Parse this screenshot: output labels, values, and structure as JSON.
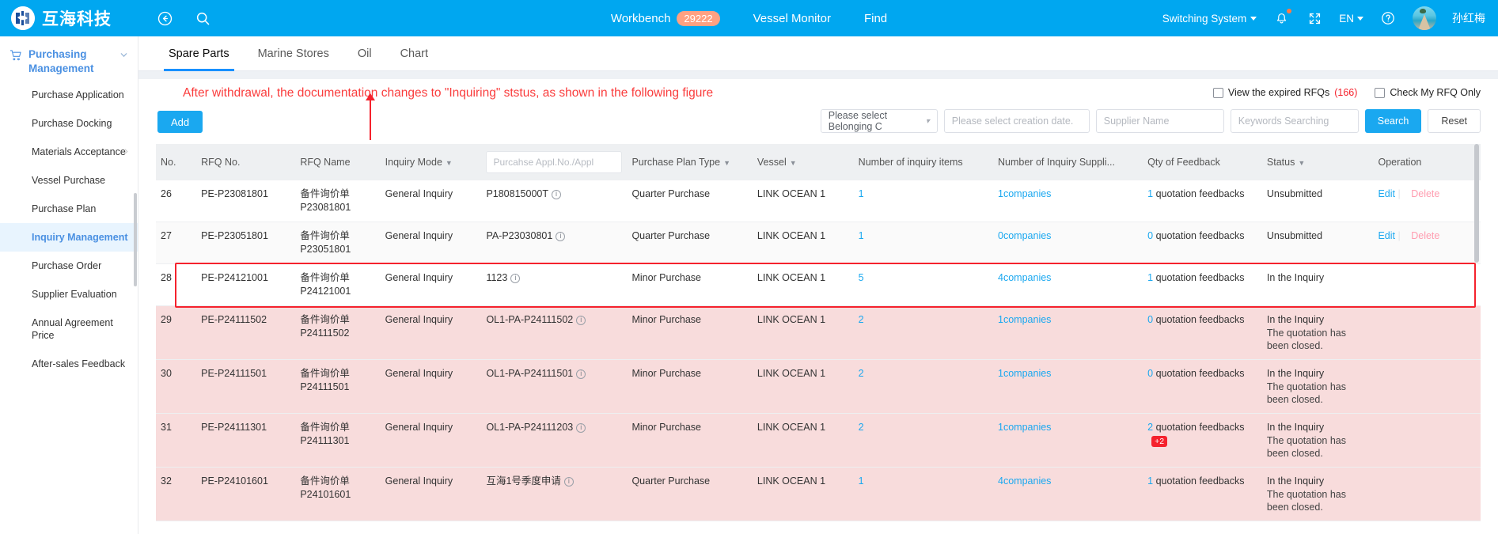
{
  "topbar": {
    "brand": "互海科技",
    "back_icon": "back-arrow-icon",
    "search_icon": "search-icon",
    "workbench_label": "Workbench",
    "workbench_count": "29222",
    "vessel_monitor_label": "Vessel Monitor",
    "find_label": "Find",
    "switching_system_label": "Switching System",
    "bell_icon": "bell-icon",
    "fullscreen_icon": "fullscreen-icon",
    "language": "EN",
    "help_icon": "help-icon",
    "username": "孙红梅",
    "accent_color": "#00a7f0",
    "badge_color": "#ffa182"
  },
  "sidebar": {
    "group_label": "Purchasing Management",
    "group_icon": "cart-icon",
    "items": [
      {
        "label": "Purchase Application",
        "active": false,
        "has_sub": false
      },
      {
        "label": "Purchase Docking",
        "active": false,
        "has_sub": false
      },
      {
        "label": "Materials Acceptance",
        "active": false,
        "has_sub": true
      },
      {
        "label": "Vessel Purchase",
        "active": false,
        "has_sub": false
      },
      {
        "label": "Purchase Plan",
        "active": false,
        "has_sub": false
      },
      {
        "label": "Inquiry Management",
        "active": true,
        "has_sub": false
      },
      {
        "label": "Purchase Order",
        "active": false,
        "has_sub": false
      },
      {
        "label": "Supplier Evaluation",
        "active": false,
        "has_sub": false
      },
      {
        "label": "Annual Agreement Price",
        "active": false,
        "has_sub": false
      },
      {
        "label": "After-sales Feedback",
        "active": false,
        "has_sub": false
      }
    ]
  },
  "tabs": [
    {
      "label": "Spare Parts",
      "active": true
    },
    {
      "label": "Marine Stores",
      "active": false
    },
    {
      "label": "Oil",
      "active": false
    },
    {
      "label": "Chart",
      "active": false
    }
  ],
  "annotation": {
    "text": "After withdrawal, the documentation changes to \"Inquiring\" ststus, as shown in the following figure",
    "color": "#fa3c3c"
  },
  "checkboxes": [
    {
      "label": "View the expired RFQs",
      "count": "(166)",
      "checked": false
    },
    {
      "label": "Check My RFQ Only",
      "count": "",
      "checked": false
    }
  ],
  "toolbar": {
    "add_label": "Add",
    "belonging_select": "Please select Belonging C",
    "creation_date_placeholder": "Please select creation date.",
    "supplier_placeholder": "Supplier Name",
    "keywords_placeholder": "Keywords Searching",
    "search_label": "Search",
    "reset_label": "Reset"
  },
  "table": {
    "columns": [
      {
        "key": "no",
        "label": "No.",
        "sort": false,
        "input": false
      },
      {
        "key": "rfq_no",
        "label": "RFQ No.",
        "sort": false,
        "input": false
      },
      {
        "key": "rfq_name",
        "label": "RFQ Name",
        "sort": false,
        "input": false
      },
      {
        "key": "mode",
        "label": "Inquiry Mode",
        "sort": true,
        "input": false
      },
      {
        "key": "appl",
        "label": "Purcahse Appl.No./Appl",
        "sort": false,
        "input": true
      },
      {
        "key": "plan_type",
        "label": "Purchase Plan Type",
        "sort": true,
        "input": false
      },
      {
        "key": "vessel",
        "label": "Vessel",
        "sort": true,
        "input": false
      },
      {
        "key": "items",
        "label": "Number of inquiry items",
        "sort": false,
        "input": false
      },
      {
        "key": "suppliers",
        "label": "Number of Inquiry Suppli...",
        "sort": false,
        "input": false
      },
      {
        "key": "feedback",
        "label": "Qty of Feedback",
        "sort": false,
        "input": false
      },
      {
        "key": "status",
        "label": "Status",
        "sort": true,
        "input": false
      },
      {
        "key": "operation",
        "label": "Operation",
        "sort": false,
        "input": false
      }
    ],
    "rows": [
      {
        "no": "26",
        "rfq_no": "PE-P23081801",
        "rfq_name": "备件询价单P23081801",
        "mode": "General Inquiry",
        "appl": "P180815000T",
        "plan_type": "Quarter Purchase",
        "vessel": "LINK OCEAN 1",
        "items": "1",
        "suppliers": "1companies",
        "feedback_n": "1",
        "feedback_text": "quotation feedbacks",
        "feedback_plus": "",
        "status": "Unsubmitted",
        "status_sub": "",
        "op_edit": "Edit",
        "op_delete": "Delete",
        "style": "clipped"
      },
      {
        "no": "27",
        "rfq_no": "PE-P23051801",
        "rfq_name": "备件询价单P23051801",
        "mode": "General Inquiry",
        "appl": "PA-P23030801",
        "plan_type": "Quarter Purchase",
        "vessel": "LINK OCEAN 1",
        "items": "1",
        "suppliers": "0companies",
        "feedback_n": "0",
        "feedback_text": "quotation feedbacks",
        "feedback_plus": "",
        "status": "Unsubmitted",
        "status_sub": "",
        "op_edit": "Edit",
        "op_delete": "Delete",
        "style": "grey"
      },
      {
        "no": "28",
        "rfq_no": "PE-P24121001",
        "rfq_name": "备件询价单P24121001",
        "mode": "General Inquiry",
        "appl": "1123",
        "plan_type": "Minor Purchase",
        "vessel": "LINK OCEAN 1",
        "items": "5",
        "suppliers": "4companies",
        "feedback_n": "1",
        "feedback_text": "quotation feedbacks",
        "feedback_plus": "",
        "status": "In the Inquiry",
        "status_sub": "",
        "op_edit": "",
        "op_delete": "",
        "style": "white"
      },
      {
        "no": "29",
        "rfq_no": "PE-P24111502",
        "rfq_name": "备件询价单P24111502",
        "mode": "General Inquiry",
        "appl": "OL1-PA-P24111502",
        "plan_type": "Minor Purchase",
        "vessel": "LINK OCEAN 1",
        "items": "2",
        "suppliers": "1companies",
        "feedback_n": "0",
        "feedback_text": "quotation feedbacks",
        "feedback_plus": "",
        "status": "In the Inquiry",
        "status_sub": "The quotation has been closed.",
        "op_edit": "",
        "op_delete": "",
        "style": "pink"
      },
      {
        "no": "30",
        "rfq_no": "PE-P24111501",
        "rfq_name": "备件询价单P24111501",
        "mode": "General Inquiry",
        "appl": "OL1-PA-P24111501",
        "plan_type": "Minor Purchase",
        "vessel": "LINK OCEAN 1",
        "items": "2",
        "suppliers": "1companies",
        "feedback_n": "0",
        "feedback_text": "quotation feedbacks",
        "feedback_plus": "",
        "status": "In the Inquiry",
        "status_sub": "The quotation has been closed.",
        "op_edit": "",
        "op_delete": "",
        "style": "pink"
      },
      {
        "no": "31",
        "rfq_no": "PE-P24111301",
        "rfq_name": "备件询价单P24111301",
        "mode": "General Inquiry",
        "appl": "OL1-PA-P24111203",
        "plan_type": "Minor Purchase",
        "vessel": "LINK OCEAN 1",
        "items": "2",
        "suppliers": "1companies",
        "feedback_n": "2",
        "feedback_text": "quotation feedbacks",
        "feedback_plus": "+2",
        "status": "In the Inquiry",
        "status_sub": "The quotation has been closed.",
        "op_edit": "",
        "op_delete": "",
        "style": "pink"
      },
      {
        "no": "32",
        "rfq_no": "PE-P24101601",
        "rfq_name": "备件询价单P24101601",
        "mode": "General Inquiry",
        "appl": "互海1号季度申请",
        "plan_type": "Quarter Purchase",
        "vessel": "LINK OCEAN 1",
        "items": "1",
        "suppliers": "4companies",
        "feedback_n": "1",
        "feedback_text": "quotation feedbacks",
        "feedback_plus": "",
        "status": "In the Inquiry",
        "status_sub": "The quotation has been closed.",
        "op_edit": "",
        "op_delete": "",
        "style": "pink"
      }
    ]
  }
}
